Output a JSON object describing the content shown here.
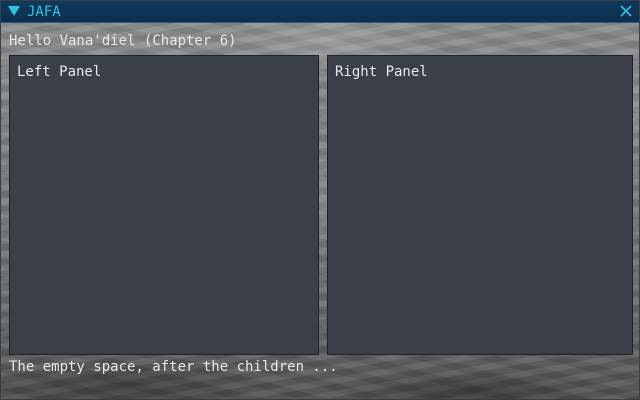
{
  "window": {
    "title": "JAFA",
    "collapse_icon": "triangle-down-icon",
    "close_icon": "close-icon"
  },
  "content": {
    "heading": "Hello Vana'diel (Chapter 6)",
    "left_panel": {
      "label": "Left Panel"
    },
    "right_panel": {
      "label": "Right Panel"
    },
    "footer": "The empty space, after the children ..."
  },
  "colors": {
    "titlebar": "#0c2f4d",
    "title_text": "#2ec4e6",
    "panel_bg": "#3b3f48",
    "text": "#e8e8e8"
  }
}
